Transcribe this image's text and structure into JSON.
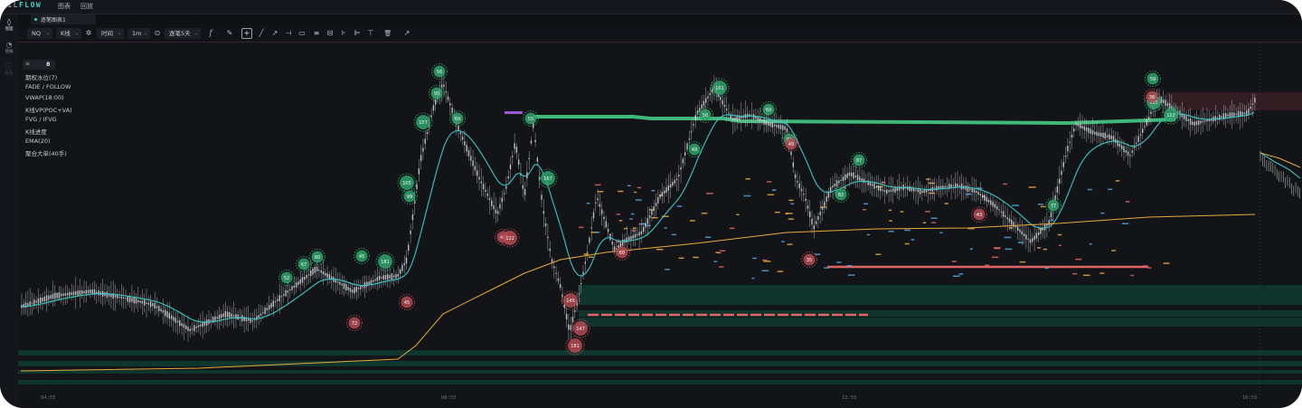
{
  "app": {
    "brand_prefix": "·IL",
    "brand_accent": "FLOW",
    "menu": [
      "图表",
      "回放"
    ]
  },
  "tab": {
    "label": "逐笔图表1"
  },
  "sidebar": {
    "items": [
      {
        "icon": "chart-icon",
        "glyph": "◊",
        "label": "盘面",
        "state": "active"
      },
      {
        "icon": "clock-icon",
        "glyph": "◔",
        "label": "情报",
        "state": "normal"
      },
      {
        "icon": "info-icon",
        "glyph": "ⓘ",
        "label": "形态",
        "state": "disabled"
      }
    ]
  },
  "toolbar": {
    "symbol": "NQ",
    "chart_type": "K线",
    "settings_glyph": "✲",
    "axis_mode": "时间",
    "timeframe": "1m",
    "range_glyph": "⊙",
    "range": "逐笔5天",
    "function_glyph": "f",
    "tools": [
      {
        "name": "pen-tool-icon",
        "glyph": "✎"
      },
      {
        "name": "crosshair-tool-icon",
        "glyph": "+"
      },
      {
        "name": "line-tool-icon",
        "glyph": "╱"
      },
      {
        "name": "ray-tool-icon",
        "glyph": "↗"
      },
      {
        "name": "horizontal-line-tool-icon",
        "glyph": "⊣"
      },
      {
        "name": "rectangle-tool-icon",
        "glyph": "▭"
      },
      {
        "name": "text-tool-icon",
        "glyph": "≡"
      },
      {
        "name": "measure-tool-icon",
        "glyph": "⊟"
      },
      {
        "name": "fib-tool-icon",
        "glyph": "⊧"
      },
      {
        "name": "position-tool-icon",
        "glyph": "⊫"
      },
      {
        "name": "anchor-tool-icon",
        "glyph": "⊤"
      },
      {
        "name": "delete-icon",
        "glyph": "🗑"
      },
      {
        "name": "external-link-icon",
        "glyph": "↗"
      }
    ]
  },
  "indicators": {
    "menu_glyph": "≡",
    "count": "8",
    "items": [
      "期权水位(7)",
      "FADE / FOLLOW",
      "VWAP(18:00)",
      "K线VP(POC+VA)",
      "FVG / IFVG",
      "K线进度",
      "EMA(20)",
      "聚合大单(40手)"
    ]
  },
  "time_axis": [
    "04:55",
    "08:55",
    "12:55",
    "16:55"
  ],
  "bubbles": {
    "green": [
      [
        "56",
        "left"
      ],
      [
        "95",
        ""
      ],
      [
        "157",
        ""
      ],
      [
        "69",
        ""
      ],
      [
        "105",
        ""
      ],
      [
        "99",
        ""
      ],
      [
        "52",
        ""
      ],
      [
        "67",
        ""
      ],
      [
        "80",
        ""
      ],
      [
        "45",
        ""
      ],
      [
        "181",
        ""
      ],
      [
        "55",
        ""
      ],
      [
        "167",
        ""
      ],
      [
        "49",
        ""
      ],
      [
        "101",
        ""
      ],
      [
        "56",
        ""
      ],
      [
        "69",
        ""
      ],
      [
        "63",
        ""
      ],
      [
        "82",
        ""
      ],
      [
        "87",
        ""
      ],
      [
        "77",
        ""
      ],
      [
        "112",
        ""
      ],
      [
        "59",
        ""
      ],
      [
        "115",
        ""
      ]
    ],
    "red": [
      "72",
      "45",
      "45",
      "122",
      "181",
      "145",
      "147",
      "68",
      "49",
      "35",
      "43",
      "38"
    ]
  },
  "colors": {
    "bg": "#131417",
    "candle": "#d4d7dc",
    "ema": "#38c8c6",
    "vwap": "#e8a93a",
    "band": "#0f3a30",
    "level_green": "#3fb87a",
    "level_red": "#e06466",
    "bubble_green": "#2fa36b",
    "bubble_red": "#b64a52"
  }
}
